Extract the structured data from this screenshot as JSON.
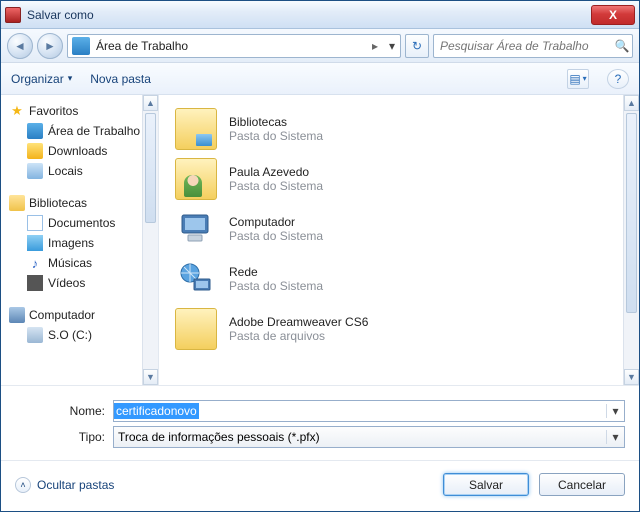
{
  "title": "Salvar como",
  "close_x": "X",
  "address": {
    "path": "Área de Trabalho",
    "arrow": "▸",
    "dropdown": "▾",
    "refresh": "↻"
  },
  "search": {
    "placeholder": "Pesquisar Área de Trabalho",
    "icon": "🔍"
  },
  "toolbar": {
    "organize": "Organizar",
    "org_dd": "▾",
    "newfolder": "Nova pasta",
    "view_icon": "▤",
    "view_dd": "▾",
    "help": "?"
  },
  "sidebar": {
    "favorites": {
      "label": "Favoritos",
      "items": [
        "Área de Trabalho",
        "Downloads",
        "Locais"
      ]
    },
    "libraries": {
      "label": "Bibliotecas",
      "items": [
        "Documentos",
        "Imagens",
        "Músicas",
        "Vídeos"
      ]
    },
    "computer": {
      "label": "Computador",
      "items": [
        "S.O (C:)"
      ]
    },
    "scroll": {
      "up": "▲",
      "down": "▼"
    }
  },
  "files": [
    {
      "name": "Bibliotecas",
      "sub": "Pasta do Sistema",
      "kind": "lib"
    },
    {
      "name": "Paula Azevedo",
      "sub": "Pasta do Sistema",
      "kind": "user"
    },
    {
      "name": "Computador",
      "sub": "Pasta do Sistema",
      "kind": "comp"
    },
    {
      "name": "Rede",
      "sub": "Pasta do Sistema",
      "kind": "net"
    },
    {
      "name": "Adobe Dreamweaver CS6",
      "sub": "Pasta de arquivos",
      "kind": "fold"
    }
  ],
  "form": {
    "name_label": "Nome:",
    "name_value": "certificadonovo",
    "type_label": "Tipo:",
    "type_value": "Troca de informações pessoais (*.pfx)",
    "dd": "▾"
  },
  "footer": {
    "hide": "Ocultar pastas",
    "chev": "˄",
    "save": "Salvar",
    "cancel": "Cancelar"
  }
}
